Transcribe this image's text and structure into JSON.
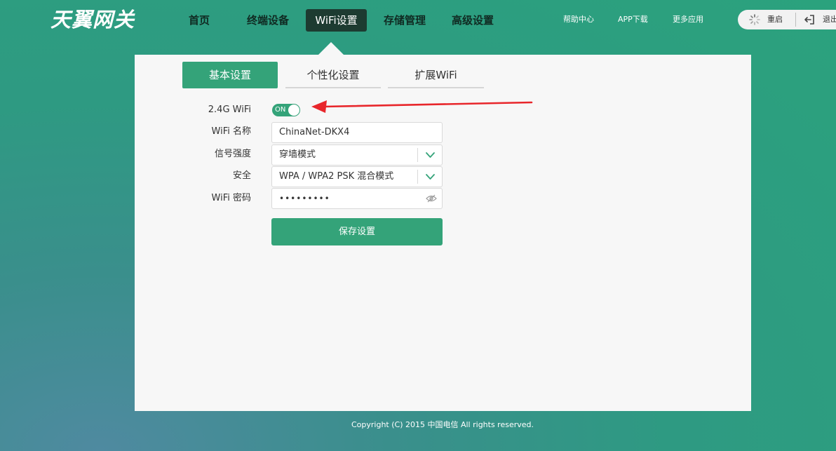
{
  "brand": {
    "logo_text": "天翼网关"
  },
  "nav": {
    "items": [
      {
        "label": "首页"
      },
      {
        "label": "终端设备"
      },
      {
        "label": "WiFi设置"
      },
      {
        "label": "存储管理"
      },
      {
        "label": "高级设置"
      }
    ],
    "active_index": 2,
    "links": [
      {
        "label": "帮助中心"
      },
      {
        "label": "APP下载"
      },
      {
        "label": "更多应用"
      }
    ],
    "restart_label": "重启",
    "logout_label": "退出"
  },
  "tabs": [
    {
      "label": "基本设置"
    },
    {
      "label": "个性化设置"
    },
    {
      "label": "扩展WiFi"
    }
  ],
  "active_tab": 0,
  "form": {
    "wifi24_label": "2.4G WiFi",
    "toggle_state": "ON",
    "name_label": "WiFi 名称",
    "name_value": "ChinaNet-DKX4",
    "signal_label": "信号强度",
    "signal_value": "穿墙模式",
    "security_label": "安全",
    "security_value": "WPA / WPA2 PSK 混合模式",
    "password_label": "WiFi 密码",
    "password_value": "•••••••••",
    "save_label": "保存设置"
  },
  "footer": {
    "copyright": "Copyright (C) 2015 中国电信 All rights reserved."
  },
  "colors": {
    "accent": "#34a379",
    "nav_active_bg": "#1d3b31",
    "annotation_arrow": "#e8262b"
  }
}
